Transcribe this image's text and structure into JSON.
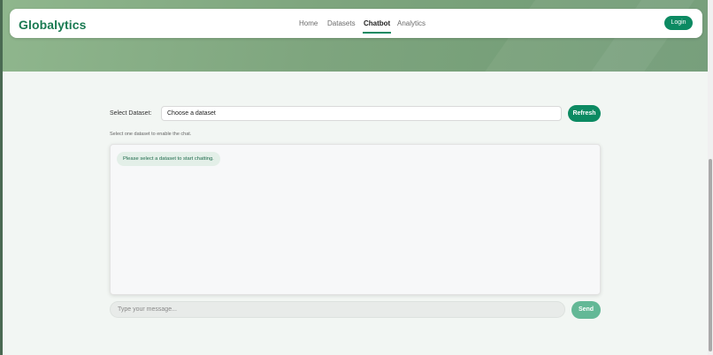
{
  "brand": "Globalytics",
  "nav": {
    "items": [
      {
        "label": "Home",
        "active": false
      },
      {
        "label": "Datasets",
        "active": false
      },
      {
        "label": "Chatbot",
        "active": true
      },
      {
        "label": "Analytics",
        "active": false
      }
    ],
    "login_label": "Login"
  },
  "dataset": {
    "label": "Select Dataset:",
    "selected": "Choose a dataset",
    "refresh_label": "Refresh",
    "hint": "Select one dataset to enable the chat."
  },
  "chat": {
    "messages": [
      "Please select a dataset to start chatting."
    ],
    "input_placeholder": "Type your message...",
    "send_label": "Send"
  },
  "colors": {
    "accent": "#0c8a62",
    "brand_text": "#1a7a52",
    "send_disabled": "#63b896"
  }
}
